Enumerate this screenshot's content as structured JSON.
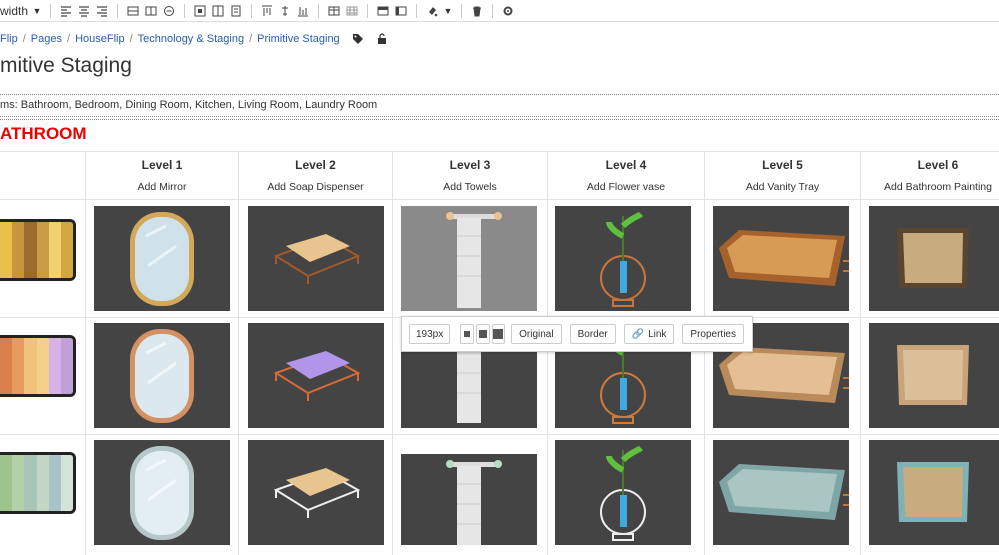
{
  "toolbar": {
    "width_label": "width"
  },
  "breadcrumb": {
    "items": [
      "Flip",
      "Pages",
      "HouseFlip",
      "Technology & Staging",
      "Primitive Staging"
    ]
  },
  "page": {
    "title": "mitive Staging",
    "rooms": "ms: Bathroom, Bedroom, Dining Room, Kitchen, Living Room, Laundry Room"
  },
  "section": {
    "title": "ATHROOM"
  },
  "table": {
    "columns": [
      {
        "level": "Level 1",
        "action": "Add Mirror"
      },
      {
        "level": "Level 2",
        "action": "Add Soap Dispenser"
      },
      {
        "level": "Level 3",
        "action": "Add Towels"
      },
      {
        "level": "Level 4",
        "action": "Add Flower vase"
      },
      {
        "level": "Level 5",
        "action": "Add Vanity Tray"
      },
      {
        "level": "Level 6",
        "action": "Add Bathroom Painting"
      }
    ],
    "swatches": [
      [
        "#e8c04a",
        "#c9953c",
        "#9a6a2e",
        "#c99b45",
        "#f0d070",
        "#d2a640"
      ],
      [
        "#d97f4e",
        "#e69a5e",
        "#f0c27a",
        "#f3cf8a",
        "#d8b2e6",
        "#bfa0d8"
      ],
      [
        "#9ec48e",
        "#b3d1a6",
        "#a8c5b8",
        "#c4d7c7",
        "#a9c4c9",
        "#d5e2d8"
      ]
    ]
  },
  "image_toolbar": {
    "size": "193px",
    "original": "Original",
    "border": "Border",
    "link": "Link",
    "properties": "Properties"
  },
  "colors": {
    "link": "#2a5db0",
    "section": "#e00000",
    "image_bg": "#444444"
  }
}
